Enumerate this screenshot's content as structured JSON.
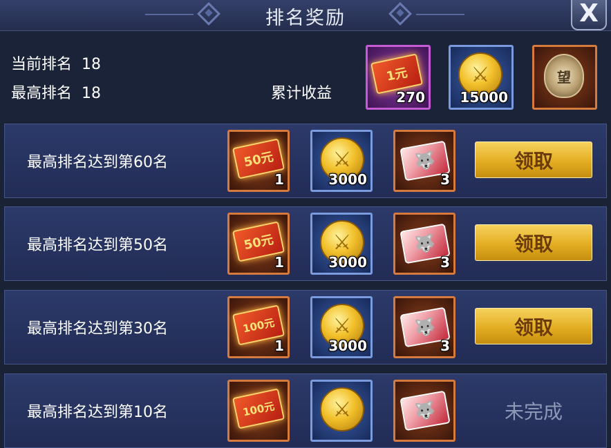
{
  "header": {
    "title": "排名奖励",
    "close_label": "X"
  },
  "summary": {
    "current_rank_label": "当前排名",
    "current_rank_value": "18",
    "best_rank_label": "最高排名",
    "best_rank_value": "18",
    "accumulated_label": "累计收益",
    "rewards": [
      {
        "icon": "red-envelope-1-yuan-icon",
        "face": "1元",
        "count": "270"
      },
      {
        "icon": "gold-coin-icon",
        "face": "",
        "count": "15000"
      },
      {
        "icon": "prestige-medal-icon",
        "face": "望",
        "count": ""
      }
    ]
  },
  "rows": [
    {
      "label": "最高排名达到第60名",
      "rewards": [
        {
          "icon": "red-envelope-50-yuan-icon",
          "face": "50元",
          "count": "1"
        },
        {
          "icon": "gold-coin-icon",
          "count": "3000"
        },
        {
          "icon": "wolf-card-icon",
          "count": "3"
        }
      ],
      "action": "领取",
      "status": "claimable"
    },
    {
      "label": "最高排名达到第50名",
      "rewards": [
        {
          "icon": "red-envelope-50-yuan-icon",
          "face": "50元",
          "count": "1"
        },
        {
          "icon": "gold-coin-icon",
          "count": "3000"
        },
        {
          "icon": "wolf-card-icon",
          "count": "3"
        }
      ],
      "action": "领取",
      "status": "claimable"
    },
    {
      "label": "最高排名达到第30名",
      "rewards": [
        {
          "icon": "red-envelope-100-yuan-icon",
          "face": "100元",
          "count": "1"
        },
        {
          "icon": "gold-coin-icon",
          "count": "3000"
        },
        {
          "icon": "wolf-card-icon",
          "count": "3"
        }
      ],
      "action": "领取",
      "status": "claimable"
    },
    {
      "label": "最高排名达到第10名",
      "rewards": [
        {
          "icon": "red-envelope-100-yuan-icon",
          "face": "100元",
          "count": ""
        },
        {
          "icon": "gold-coin-icon",
          "count": ""
        },
        {
          "icon": "wolf-card-icon",
          "count": ""
        }
      ],
      "action": "未完成",
      "status": "incomplete"
    }
  ],
  "colors": {
    "claim_button": "#e3ae22",
    "row_background": "#2c3a6a",
    "incomplete_text": "#8e98b8"
  }
}
